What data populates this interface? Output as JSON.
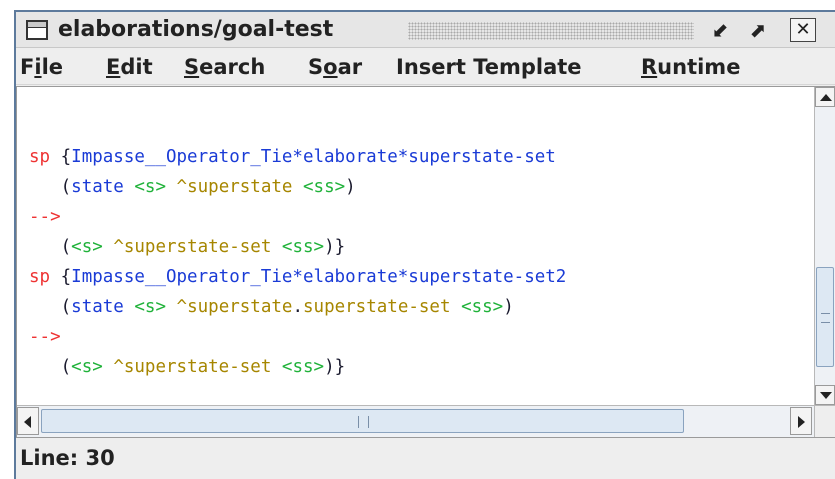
{
  "window": {
    "title": "elaborations/goal-test",
    "minimize_glyph": "⬋",
    "maximize_glyph": "⬈",
    "close_glyph": "☒"
  },
  "menu": {
    "file": {
      "mnemonic": "i",
      "pre": "F",
      "post": "le"
    },
    "edit": {
      "mnemonic": "E",
      "pre": "",
      "post": "dit"
    },
    "search": {
      "mnemonic": "S",
      "pre": "",
      "post": "earch"
    },
    "soar": {
      "mnemonic": "o",
      "pre": "S",
      "post": "ar"
    },
    "insert_template": "Insert Template",
    "runtime": {
      "mnemonic": "R",
      "pre": "",
      "post": "untime"
    }
  },
  "code": {
    "line1": {
      "kw": "sp",
      "brace": " {",
      "name": "Impasse__Operator_Tie*elaborate*superstate-set"
    },
    "line2": {
      "indent": "   (",
      "state": "state",
      "sp1": " ",
      "var": "<s>",
      "sp2": " ",
      "attr": "^superstate",
      "sp3": " ",
      "val": "<ss>",
      "close": ")"
    },
    "line3": {
      "arrow": "-->"
    },
    "line4": {
      "indent": "   (",
      "var": "<s>",
      "sp1": " ",
      "attr": "^superstate-set",
      "sp2": " ",
      "val": "<ss>",
      "close": ")}"
    },
    "line5": {
      "kw": "sp",
      "brace": " {",
      "name": "Impasse__Operator_Tie*elaborate*superstate-set2"
    },
    "line6": {
      "indent": "   (",
      "state": "state",
      "sp1": " ",
      "var": "<s>",
      "sp2": " ",
      "attr1": "^superstate",
      "dot": ".",
      "attr2": "superstate-set",
      "sp3": " ",
      "val": "<ss>",
      "close": ")"
    },
    "line7": {
      "arrow": "-->"
    },
    "line8": {
      "indent": "   (",
      "var": "<s>",
      "sp1": " ",
      "attr": "^superstate-set",
      "sp2": " ",
      "val": "<ss>",
      "close": ")}"
    }
  },
  "status": {
    "line_label": "Line: 30"
  },
  "colors": {
    "keyword": "#ee3333",
    "identifier": "#1a3bd6",
    "variable": "#20b23a",
    "attribute": "#a68600"
  }
}
